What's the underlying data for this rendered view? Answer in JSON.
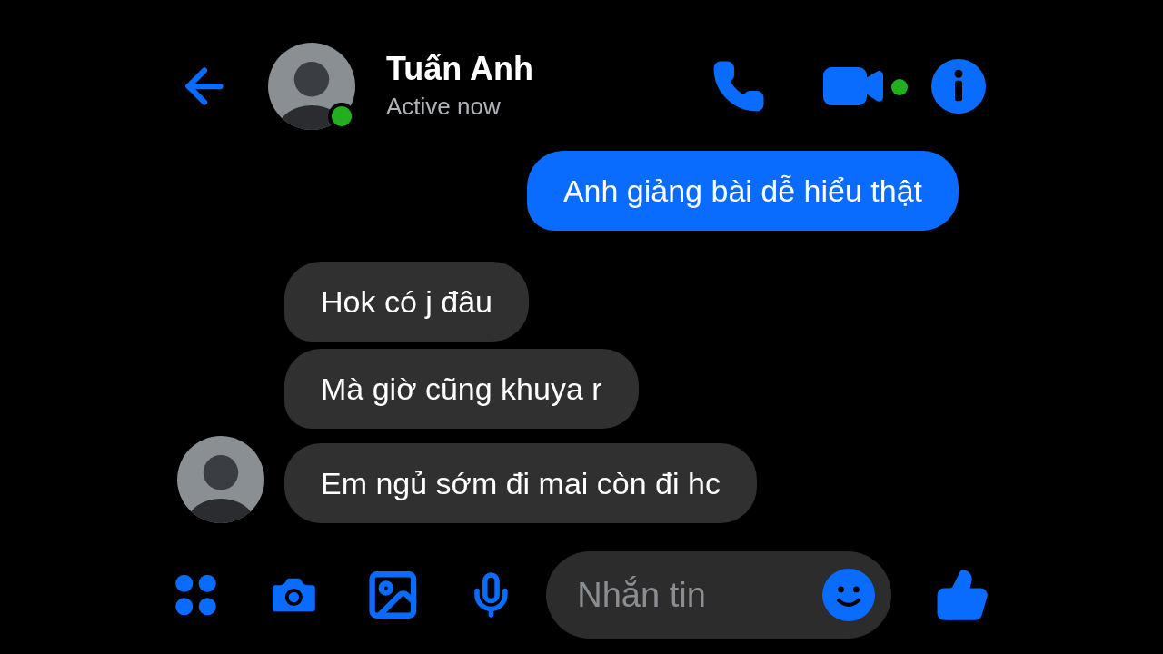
{
  "header": {
    "name": "Tuấn Anh",
    "status": "Active now",
    "online": true
  },
  "messages": [
    {
      "text": "Anh giảng bài dễ hiểu thật",
      "outgoing": true
    },
    {
      "text": "Hok có j đâu",
      "outgoing": false,
      "show_avatar": false
    },
    {
      "text": "Mà giờ cũng khuya r",
      "outgoing": false,
      "show_avatar": false
    },
    {
      "text": "Em ngủ sớm đi mai còn đi hc",
      "outgoing": false,
      "show_avatar": true
    }
  ],
  "composer": {
    "placeholder": "Nhắn tin"
  }
}
